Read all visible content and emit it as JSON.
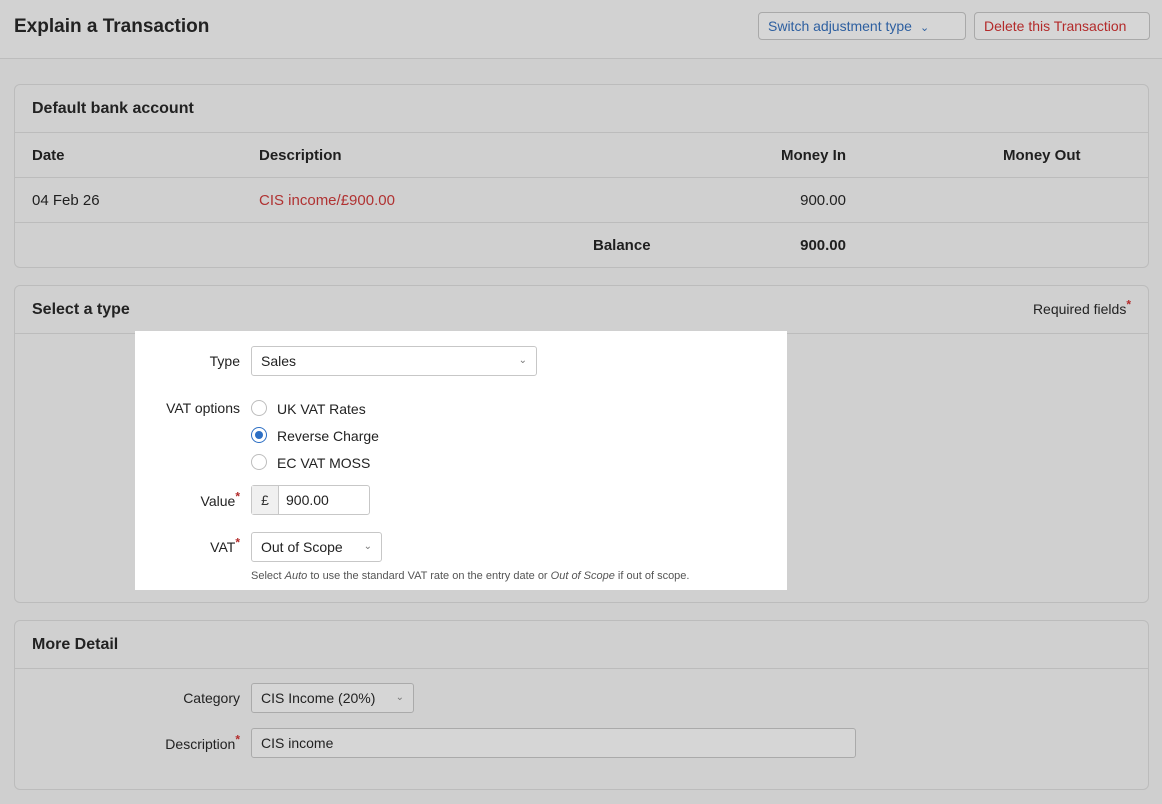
{
  "header": {
    "title": "Explain a Transaction",
    "switch_label": "Switch adjustment type",
    "delete_label": "Delete this Transaction"
  },
  "bank_panel": {
    "title": "Default bank account",
    "columns": [
      "Date",
      "Description",
      "Money In",
      "Money Out"
    ],
    "rows": [
      {
        "date": "04 Feb 26",
        "description": "CIS income/£900.00",
        "money_in": "900.00",
        "money_out": ""
      }
    ],
    "balance_label": "Balance",
    "balance_value": "900.00"
  },
  "type_panel": {
    "title": "Select a type",
    "required_label": "Required fields",
    "type_label": "Type",
    "type_value": "Sales",
    "vat_options_label": "VAT options",
    "vat_options": [
      {
        "label": "UK VAT Rates",
        "selected": false
      },
      {
        "label": "Reverse Charge",
        "selected": true
      },
      {
        "label": "EC VAT MOSS",
        "selected": false
      }
    ],
    "value_label": "Value",
    "currency_symbol": "£",
    "value": "900.00",
    "vat_label": "VAT",
    "vat_value": "Out of Scope",
    "hint_parts": [
      "Select ",
      "Auto",
      " to use the standard VAT rate on the entry date or ",
      "Out of Scope",
      " if out of scope."
    ]
  },
  "more_panel": {
    "title": "More Detail",
    "category_label": "Category",
    "category_value": "CIS Income (20%)",
    "description_label": "Description",
    "description_value": "CIS income"
  },
  "colors": {
    "accent_blue": "#2d6fc4",
    "danger_red": "#b32a2a",
    "link_red": "#b03232"
  }
}
